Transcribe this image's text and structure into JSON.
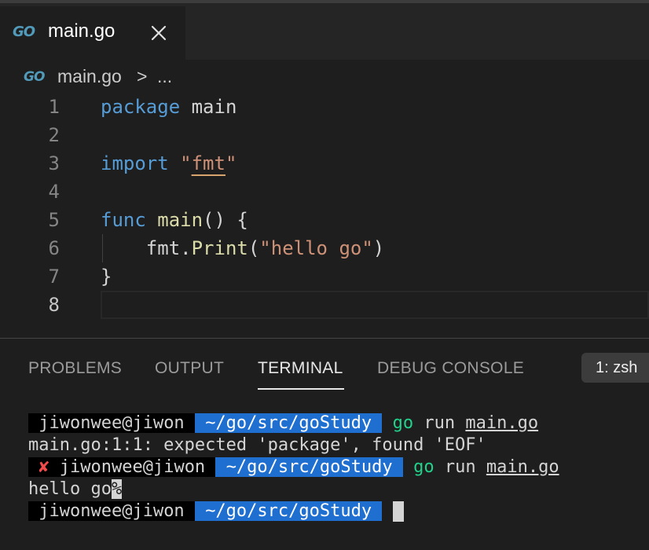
{
  "tab": {
    "icon": "go-file-icon",
    "icon_text": "GO",
    "label": "main.go",
    "close_icon": "close-icon"
  },
  "breadcrumb": {
    "icon": "go-file-icon",
    "icon_text": "GO",
    "file": "main.go",
    "separator": ">",
    "more": "..."
  },
  "editor": {
    "active_line": 8,
    "lines": [
      {
        "num": "1",
        "tokens": [
          {
            "t": "package",
            "c": "kw"
          },
          {
            "t": " main",
            "c": "plain"
          }
        ]
      },
      {
        "num": "2",
        "tokens": []
      },
      {
        "num": "3",
        "tokens": [
          {
            "t": "import",
            "c": "kw"
          },
          {
            "t": " ",
            "c": "plain"
          },
          {
            "t": "\"",
            "c": "str"
          },
          {
            "t": "fmt",
            "c": "str squiggle"
          },
          {
            "t": "\"",
            "c": "str"
          }
        ]
      },
      {
        "num": "4",
        "tokens": []
      },
      {
        "num": "5",
        "tokens": [
          {
            "t": "func",
            "c": "kw"
          },
          {
            "t": " ",
            "c": "plain"
          },
          {
            "t": "main",
            "c": "fn"
          },
          {
            "t": "() {",
            "c": "plain"
          }
        ]
      },
      {
        "num": "6",
        "tokens": [
          {
            "t": "    fmt.",
            "c": "plain"
          },
          {
            "t": "Print",
            "c": "fn"
          },
          {
            "t": "(",
            "c": "plain"
          },
          {
            "t": "\"hello go\"",
            "c": "str"
          },
          {
            "t": ")",
            "c": "plain"
          }
        ]
      },
      {
        "num": "7",
        "tokens": [
          {
            "t": "}",
            "c": "plain"
          }
        ]
      },
      {
        "num": "8",
        "tokens": []
      }
    ]
  },
  "panel": {
    "tabs": [
      "PROBLEMS",
      "OUTPUT",
      "TERMINAL",
      "DEBUG CONSOLE"
    ],
    "active_tab": "TERMINAL",
    "shell": "1: zsh"
  },
  "terminal": {
    "user": "jiwonwee@jiwon",
    "path": "~/go/src/goStudy",
    "prompt_glyph": "",
    "command_go": "go",
    "command_run": "run",
    "command_file": "main.go",
    "error_line": "main.go:1:1: expected 'package', found 'EOF'",
    "error_mark": "✘",
    "output_line": "hello go",
    "no_newline_mark": "%"
  },
  "colors": {
    "editor_bg": "#1e1e1e",
    "keyword": "#569cd6",
    "string": "#ce9178",
    "function": "#dcdcaa",
    "prompt_path_bg": "#1f6fd1",
    "go_command": "#23d18b",
    "error": "#f14c4c"
  }
}
